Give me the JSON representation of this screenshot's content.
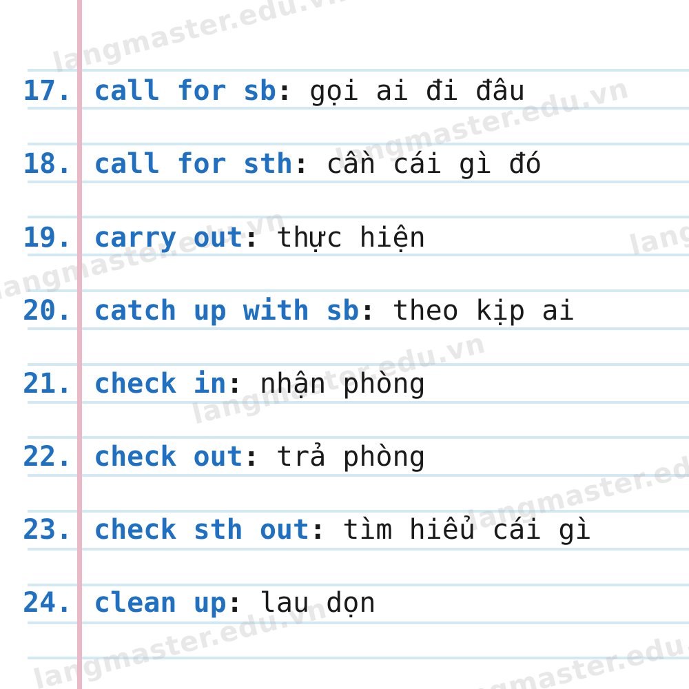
{
  "entries": [
    {
      "num": "17.",
      "term": "call for sb",
      "colon": ":",
      "meaning": " gọi ai đi đâu"
    },
    {
      "num": "18.",
      "term": "call for sth",
      "colon": ":",
      "meaning": " cần cái gì đó"
    },
    {
      "num": "19.",
      "term": "carry out",
      "colon": ":",
      "meaning": " thực hiện"
    },
    {
      "num": "20.",
      "term": "catch up with sb",
      "colon": ":",
      "meaning": " theo kịp ai"
    },
    {
      "num": "21.",
      "term": "check in",
      "colon": ":",
      "meaning": " nhận phòng"
    },
    {
      "num": "22.",
      "term": "check out",
      "colon": ":",
      "meaning": " trả phòng"
    },
    {
      "num": "23.",
      "term": "check sth out",
      "colon": ":",
      "meaning": " tìm hiểu cái gì"
    },
    {
      "num": "24.",
      "term": "clean up",
      "colon": ":",
      "meaning": " lau dọn"
    }
  ],
  "watermark": {
    "text": "langmaster.edu.vn"
  },
  "colors": {
    "term": "#1f6fc2",
    "meaning": "#1a1a1a",
    "rule": "#d2e8f2",
    "margin": "#eab8c6"
  }
}
